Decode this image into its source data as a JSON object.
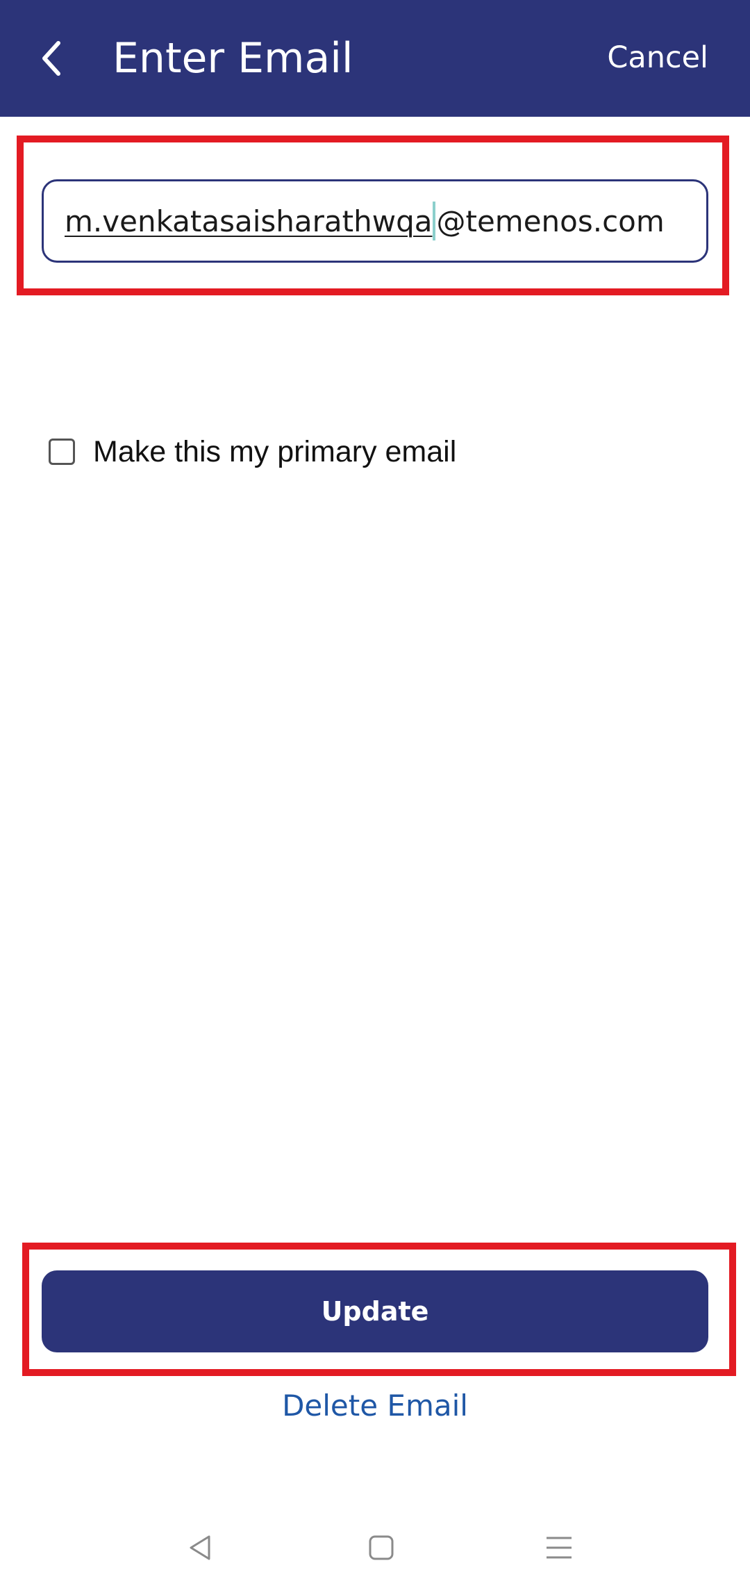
{
  "header": {
    "title": "Enter Email",
    "cancel_label": "Cancel",
    "background_color": "#2c3479"
  },
  "email_field": {
    "value_composing": "m.venkatasaisharathwqa",
    "value_rest": "@temenos.com"
  },
  "primary_checkbox": {
    "label": "Make this my primary email",
    "checked": false
  },
  "actions": {
    "update_label": "Update",
    "delete_label": "Delete Email"
  },
  "icons": {
    "back": "chevron-left-icon",
    "nav_back": "triangle-back-icon",
    "nav_home": "square-home-icon",
    "nav_menu": "hamburger-menu-icon"
  },
  "colors": {
    "primary": "#2c3479",
    "link": "#1f57a6",
    "highlight": "#e31b23"
  }
}
